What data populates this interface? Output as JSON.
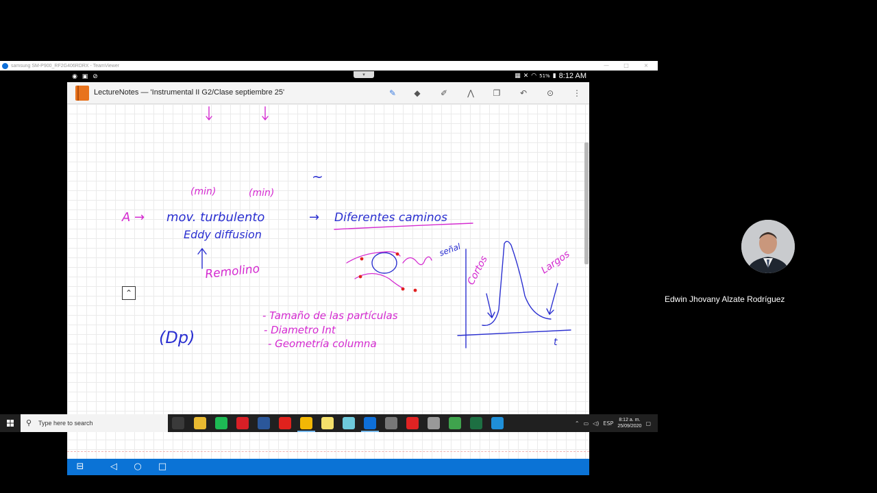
{
  "teamviewer": {
    "window_title": "samsung SM-P900_RF2G406RDRX - TeamViewer",
    "minimize": "—",
    "maximize": "□",
    "close": "×"
  },
  "android_status": {
    "handle": "▾",
    "battery": "51%",
    "time": "8:12 AM"
  },
  "app": {
    "title": "LectureNotes — 'Instrumental II G2/Clase septiembre 25'",
    "tools": [
      {
        "name": "pen-tool-icon",
        "glyph": "✎",
        "color": "#3a7be0"
      },
      {
        "name": "eraser-tool-icon",
        "glyph": "◆",
        "color": "#555"
      },
      {
        "name": "highlighter-tool-icon",
        "glyph": "✐",
        "color": "#555"
      },
      {
        "name": "compass-tool-icon",
        "glyph": "⋀",
        "color": "#555"
      },
      {
        "name": "copy-tool-icon",
        "glyph": "❐",
        "color": "#555"
      },
      {
        "name": "undo-icon",
        "glyph": "↶",
        "color": "#555"
      },
      {
        "name": "camera-icon",
        "glyph": "⊙",
        "color": "#555"
      },
      {
        "name": "more-menu-icon",
        "glyph": "⋮",
        "color": "#555"
      }
    ]
  },
  "notes": {
    "unit1": "(min)",
    "unit2": "(min)",
    "tilde": "~",
    "line_a_prefix": "A →",
    "line_a_mov": "mov. turbulento",
    "arrow": "→",
    "diferentes": "Diferentes caminos",
    "eddy": "Eddy diffusion",
    "remolino": "Remolino",
    "dp": "(Dp)",
    "bullet1": "- Tamaño de las partículas",
    "bullet2": "- Diametro Int",
    "bullet3": "- Geometría columna",
    "senal": "señal",
    "cortos": "Cortos",
    "largos": "Largos",
    "t_axis": "t",
    "colors": {
      "blue": "#2a2fd0",
      "magenta": "#d42ad0",
      "red": "#e02020"
    }
  },
  "collapse_button": "⌃",
  "nav_bar": {
    "teamviewer_icon": "teamviewer-icon",
    "back": "◁",
    "home": "○",
    "recents": "□"
  },
  "video": {
    "participant_name": "Edwin Jhovany Alzate Rodríguez"
  },
  "taskbar": {
    "search_placeholder": "Type here to search",
    "language": "ESP",
    "clock_time": "8:12 a. m.",
    "clock_date": "25/09/2020",
    "apps": [
      {
        "name": "task-view-icon",
        "color": "#3a3a3a",
        "active": false
      },
      {
        "name": "file-explorer-icon",
        "color": "#e8b931",
        "active": false
      },
      {
        "name": "spotify-icon",
        "color": "#1db954",
        "active": false
      },
      {
        "name": "netflix-icon",
        "color": "#d81f26",
        "active": false
      },
      {
        "name": "word-icon",
        "color": "#2b579a",
        "active": false
      },
      {
        "name": "acrobat-icon",
        "color": "#e0221d",
        "active": false
      },
      {
        "name": "chrome-icon",
        "color": "#f2b705",
        "active": true
      },
      {
        "name": "sticky-notes-icon",
        "color": "#f4e06b",
        "active": false
      },
      {
        "name": "slack-icon",
        "color": "#6ecadc",
        "active": false
      },
      {
        "name": "teamviewer-taskbar-icon",
        "color": "#0e6fd8",
        "active": true
      },
      {
        "name": "snip-icon",
        "color": "#777",
        "active": false
      },
      {
        "name": "record-icon",
        "color": "#e02323",
        "active": false
      },
      {
        "name": "settings-app-icon",
        "color": "#999",
        "active": false
      },
      {
        "name": "camtasia-icon",
        "color": "#3fa34d",
        "active": false
      },
      {
        "name": "excel-icon",
        "color": "#1d6f42",
        "active": false
      },
      {
        "name": "edge-icon",
        "color": "#1f8fd8",
        "active": false
      }
    ]
  }
}
